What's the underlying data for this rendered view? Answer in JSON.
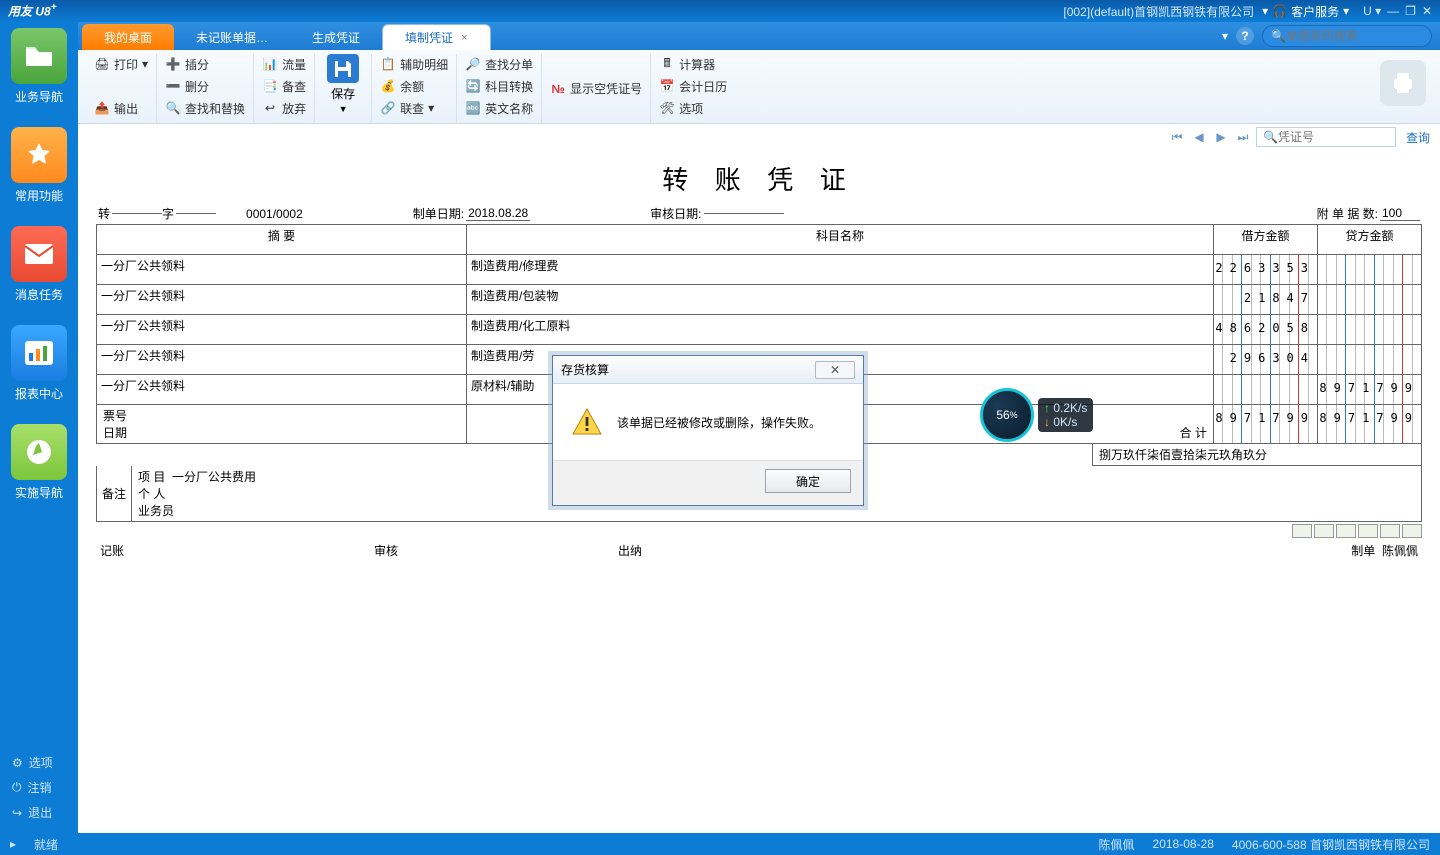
{
  "titlebar": {
    "logo": "用友 U8",
    "logo_sup": "+",
    "company": "[002](default)首钢凯西钢铁有限公司",
    "service": "客户服务",
    "u": "U"
  },
  "sidebar": {
    "items": [
      {
        "label": "业务导航"
      },
      {
        "label": "常用功能"
      },
      {
        "label": "消息任务"
      },
      {
        "label": "报表中心"
      },
      {
        "label": "实施导航"
      }
    ],
    "footer": [
      {
        "label": "选项"
      },
      {
        "label": "注销"
      },
      {
        "label": "退出"
      }
    ]
  },
  "tabs": [
    {
      "label": "我的桌面"
    },
    {
      "label": "未记账单据…"
    },
    {
      "label": "生成凭证"
    },
    {
      "label": "填制凭证"
    }
  ],
  "search_placeholder": "单据条码搜索",
  "ribbon": {
    "g1": [
      {
        "l": "打印"
      },
      {
        "l": "输出"
      }
    ],
    "g2": [
      {
        "l": "插分"
      },
      {
        "l": "删分"
      },
      {
        "l": "查找和替换"
      }
    ],
    "g3": [
      {
        "l": "流量"
      },
      {
        "l": "备查"
      },
      {
        "l": "放弃"
      }
    ],
    "save": "保存",
    "g4": [
      {
        "l": "辅助明细"
      },
      {
        "l": "余额"
      },
      {
        "l": "联查"
      }
    ],
    "g5": [
      {
        "l": "查找分单"
      },
      {
        "l": "科目转换"
      },
      {
        "l": "英文名称"
      }
    ],
    "showEmpty": "显示空凭证号",
    "g6": [
      {
        "l": "计算器"
      },
      {
        "l": "会计日历"
      },
      {
        "l": "选项"
      }
    ]
  },
  "nosearch_placeholder": "凭证号",
  "query_label": "查询",
  "voucher": {
    "title": "转 账 凭 证",
    "zhuanzi": "转",
    "zi": "字",
    "no": "0001/0002",
    "make_date_lbl": "制单日期:",
    "make_date": "2018.08.28",
    "audit_date_lbl": "审核日期:",
    "audit_date": "",
    "attach_lbl": "附 单 据 数:",
    "attach": "100",
    "cols": {
      "summary": "摘 要",
      "subject": "科目名称",
      "debit": "借方金额",
      "credit": "贷方金额"
    },
    "rows": [
      {
        "s": "一分厂公共领料",
        "k": "制造费用/修理费",
        "d": "2263353",
        "c": ""
      },
      {
        "s": "一分厂公共领料",
        "k": "制造费用/包装物",
        "d": "21847",
        "c": ""
      },
      {
        "s": "一分厂公共领料",
        "k": "制造费用/化工原料",
        "d": "4862058",
        "c": ""
      },
      {
        "s": "一分厂公共领料",
        "k": "制造费用/劳",
        "d": "296304",
        "c": ""
      },
      {
        "s": "一分厂公共领料",
        "k": "原材料/辅助",
        "d": "",
        "c": "8971799"
      }
    ],
    "total_lbl": "合 计",
    "total_d": "8971799",
    "total_c": "8971799",
    "ticket_no": "票号",
    "ticket_date": "日期",
    "cn_amount": "捌万玖仟柒佰壹拾柒元玖角玖分",
    "remark_lbl": "备注",
    "project_lbl": "项 目",
    "project_val": "一分厂公共费用",
    "person_lbl": "个 人",
    "biz_lbl": "业务员",
    "bk": "记账",
    "audit": "审核",
    "cashier": "出纳",
    "maker_lbl": "制单",
    "maker": "陈佩佩"
  },
  "dialog": {
    "title": "存货核算",
    "msg": "该单据已经被修改或删除，操作失败。",
    "ok": "确定"
  },
  "net": {
    "pct": "56",
    "unit": "%",
    "up": "0.2K/s",
    "down": "0K/s"
  },
  "status": {
    "ready": "就绪",
    "user": "陈佩佩",
    "date": "2018-08-28",
    "hotline": "4006-600-588 首钢凯西钢铁有限公司"
  }
}
